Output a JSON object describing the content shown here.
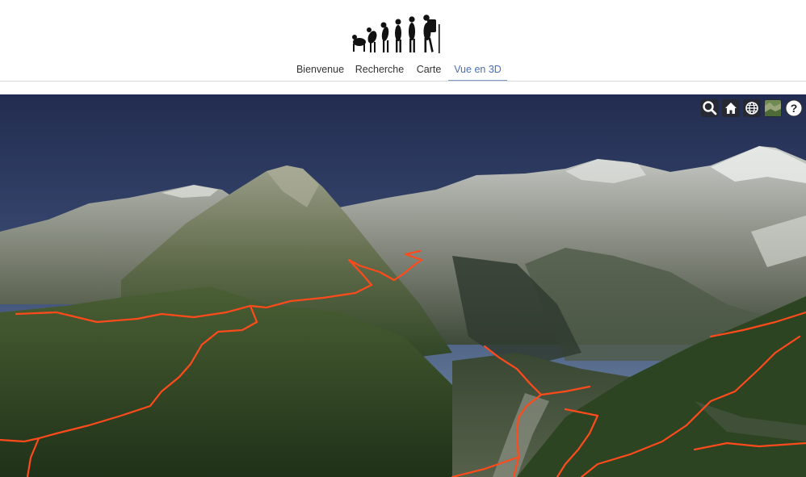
{
  "header": {
    "logo_icon": "human-evolution-hiker-logo",
    "nav": [
      {
        "label": "Bienvenue",
        "active": false
      },
      {
        "label": "Recherche",
        "active": false
      },
      {
        "label": "Carte",
        "active": false
      },
      {
        "label": "Vue en 3D",
        "active": true
      }
    ]
  },
  "viewer": {
    "toolbar": [
      {
        "icon": "search-icon"
      },
      {
        "icon": "home-icon"
      },
      {
        "icon": "globe-icon"
      },
      {
        "icon": "base-layer-picker-icon"
      },
      {
        "icon": "help-icon",
        "label": "?"
      }
    ],
    "colors": {
      "trail": "#ff4a1c",
      "sky_top": "#243056",
      "sky_horizon": "#4e6387",
      "forest": "#2e4422",
      "accent_nav": "#4a6fb0"
    }
  }
}
